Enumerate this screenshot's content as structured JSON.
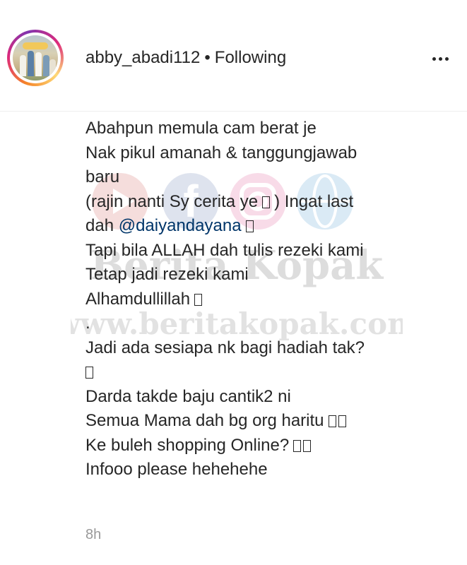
{
  "header": {
    "username": "abby_abadi112",
    "separator": "•",
    "follow_status": "Following",
    "avatar_icon": "profile-photo",
    "more_icon": "more-options-icon"
  },
  "caption": {
    "lines": [
      "Abahpun memula cam berat je",
      "Nak pikul amanah & tanggungjawab",
      "baru",
      "(rajin nanti Sy cerita ye",
      ") Ingat last",
      "dah",
      "@daiyandayana",
      "Tapi bila ALLAH dah tulis rezeki kami",
      "Tetap jadi rezeki kami",
      "Alhamdullillah",
      ".",
      "Jadi ada sesiapa nk bagi hadiah tak?",
      "Darda takde baju cantik2 ni",
      "Semua Mama dah bg org haritu",
      "Ke buleh shopping Online?",
      "Infooo please hehehehe"
    ]
  },
  "watermark": {
    "brand": "Berita Kopak",
    "url": "www.beritakopak.com"
  },
  "footer": {
    "timestamp": "8h"
  },
  "colors": {
    "text": "#262626",
    "mention": "#003569",
    "muted": "#999999",
    "divider": "#efefef"
  }
}
